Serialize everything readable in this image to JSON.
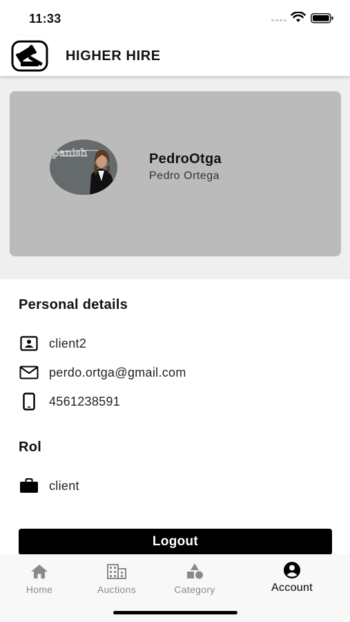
{
  "status_bar": {
    "time": "11:33",
    "icons": [
      "signal-dots-icon",
      "wifi-icon",
      "battery-icon"
    ]
  },
  "header": {
    "logo_icon": "gavel-logo-icon",
    "title": "HIGHER HIRE"
  },
  "profile": {
    "username": "PedroOtga",
    "full_name": "Pedro Ortega",
    "avatar_chalkboard_text": "panish",
    "card_color": "#bbbbbb"
  },
  "personal_details": {
    "title": "Personal details",
    "rows": [
      {
        "icon": "id-badge-icon",
        "value": "client2"
      },
      {
        "icon": "mail-icon",
        "value": "perdo.ortga@gmail.com"
      },
      {
        "icon": "phone-icon",
        "value": "4561238591"
      }
    ]
  },
  "role": {
    "title": "Rol",
    "icon": "briefcase-icon",
    "value": "client"
  },
  "logout": {
    "label": "Logout"
  },
  "bottom_nav": {
    "items": [
      {
        "icon": "home-icon",
        "label": "Home",
        "active": false
      },
      {
        "icon": "building-icon",
        "label": "Auctions",
        "active": false
      },
      {
        "icon": "shapes-icon",
        "label": "Category",
        "active": false
      },
      {
        "icon": "account-circle-icon",
        "label": "Account",
        "active": true
      }
    ]
  }
}
